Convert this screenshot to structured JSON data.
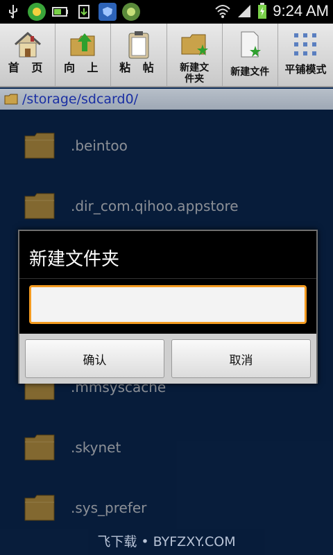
{
  "status_bar": {
    "time": "9:24 AM",
    "icons": [
      "usb-icon",
      "app-icon-1",
      "battery-app-icon",
      "download-icon",
      "shield-icon",
      "app-icon-2",
      "wifi-icon",
      "signal-icon",
      "battery-icon"
    ]
  },
  "toolbar": {
    "buttons": [
      {
        "label": "首 页",
        "icon": "home-icon"
      },
      {
        "label": "向 上",
        "icon": "up-folder-icon"
      },
      {
        "label": "粘 帖",
        "icon": "clipboard-icon"
      },
      {
        "label": "新建文\n件夹",
        "icon": "new-folder-icon"
      },
      {
        "label": "新建文件",
        "icon": "new-file-icon"
      },
      {
        "label": "平铺模式",
        "icon": "grid-mode-icon"
      }
    ]
  },
  "path": {
    "current": "/storage/sdcard0/"
  },
  "files": [
    {
      "name": ".beintoo"
    },
    {
      "name": ".dir_com.qihoo.appstore"
    },
    {
      "name": ""
    },
    {
      "name": ""
    },
    {
      "name": ".mmsyscache"
    },
    {
      "name": ".skynet"
    },
    {
      "name": ".sys_prefer"
    }
  ],
  "dialog": {
    "title": "新建文件夹",
    "input_value": "",
    "confirm_label": "确认",
    "cancel_label": "取消"
  },
  "watermark": "飞下载 • BYFZXY.COM",
  "colors": {
    "accent_input_border": "#f39a1f",
    "list_background": "#0c2c5a",
    "path_text": "#1a2fa3"
  }
}
